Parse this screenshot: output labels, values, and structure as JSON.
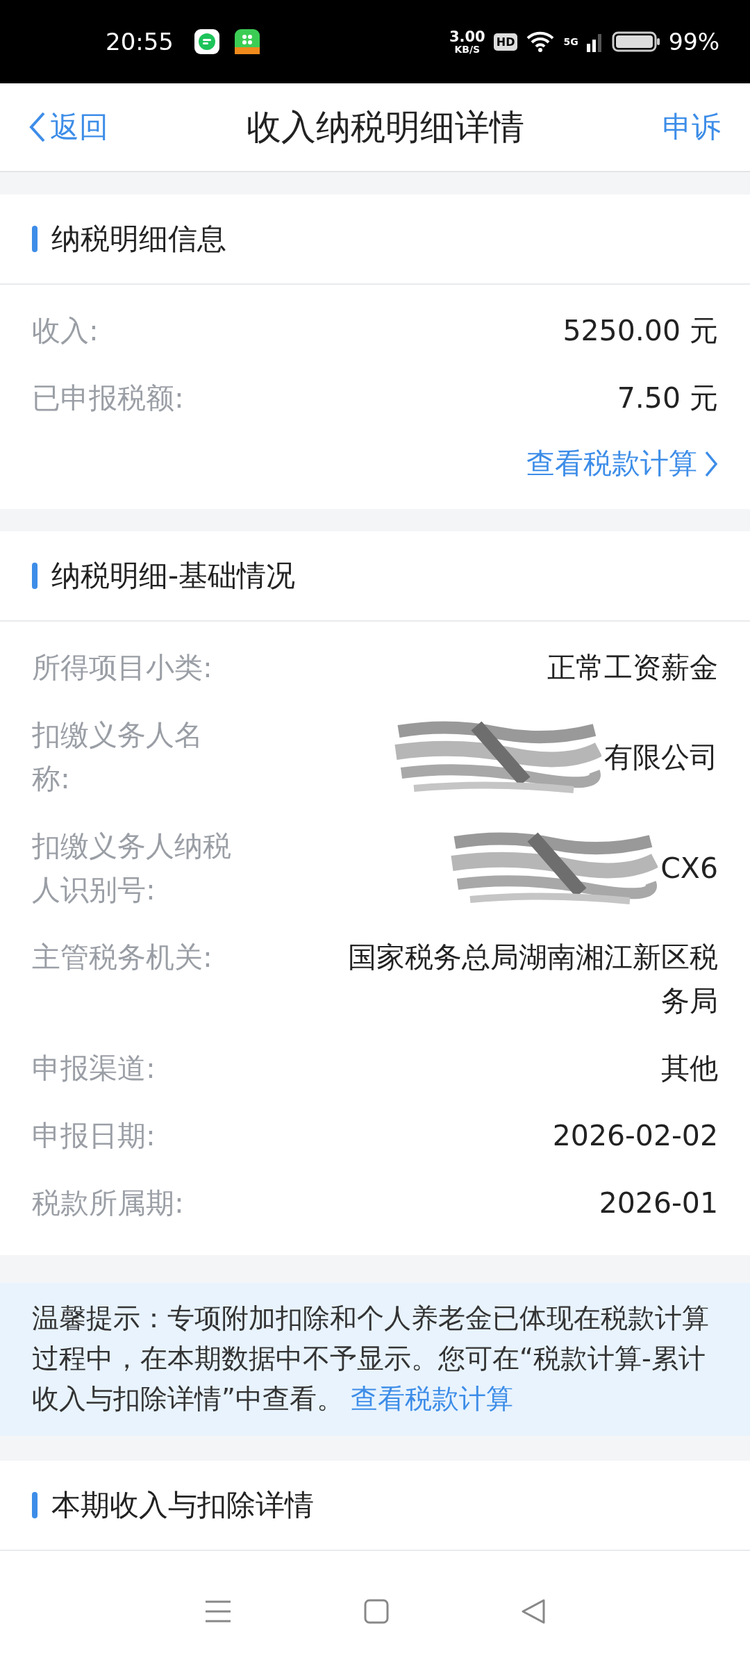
{
  "status_bar": {
    "time": "20:55",
    "speed": "3.00",
    "speed_unit": "KB/S",
    "hd": "HD",
    "network": "5G",
    "battery": "99%"
  },
  "nav": {
    "back": "返回",
    "title": "收入纳税明细详情",
    "action": "申诉"
  },
  "sections": [
    {
      "title": "纳税明细信息",
      "rows": [
        {
          "label": "收入:",
          "value": "5250.00 元",
          "kind": "plain"
        },
        {
          "label": "已申报税额:",
          "value": "7.50 元",
          "kind": "plain"
        }
      ],
      "link": "查看税款计算"
    },
    {
      "title": "纳税明细-基础情况",
      "rows": [
        {
          "label": "所得项目小类:",
          "value": "正常工资薪金",
          "kind": "plain"
        },
        {
          "label": "扣缴义务人名称:",
          "value": "有限公司",
          "kind": "redacted"
        },
        {
          "label": "扣缴义务人纳税人识别号:",
          "value": "CX6",
          "kind": "redacted"
        },
        {
          "label": "主管税务机关:",
          "value": "国家税务总局湖南湘江新区税务局",
          "kind": "plain"
        },
        {
          "label": "申报渠道:",
          "value": "其他",
          "kind": "plain"
        },
        {
          "label": "申报日期:",
          "value": "2026-02-02",
          "kind": "plain"
        },
        {
          "label": "税款所属期:",
          "value": "2026-01",
          "kind": "plain"
        }
      ]
    }
  ],
  "tip": {
    "text": "温馨提示：专项附加扣除和个人养老金已体现在税款计算过程中，在本期数据中不予显示。您可在“税款计算-累计收入与扣除详情”中查看。",
    "link": "查看税款计算"
  },
  "sections_after": [
    {
      "title": "本期收入与扣除详情"
    }
  ]
}
